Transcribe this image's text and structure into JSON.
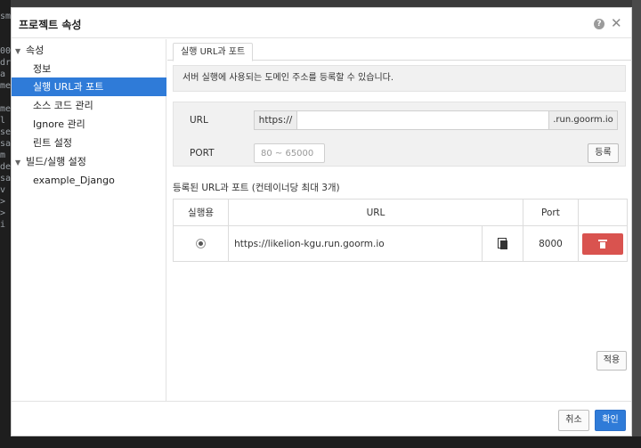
{
  "background": {
    "code_lines": [
      "sm",
      "",
      "00",
      "dr",
      "a",
      "me",
      "me",
      "l",
      "se",
      "sa",
      "m",
      "de",
      "sa",
      "dy",
      "v",
      ">",
      ">",
      "i"
    ]
  },
  "dialog": {
    "title": "프로젝트 속성",
    "help_glyph": "?",
    "close_glyph": "✕"
  },
  "sidebar": {
    "groups": [
      {
        "label": "속성",
        "expanded": true,
        "items": [
          "정보",
          "실행 URL과 포트",
          "소스 코드 관리",
          "Ignore 관리",
          "린트 설정"
        ]
      },
      {
        "label": "빌드/실행 설정",
        "expanded": true,
        "items": [
          "example_Django"
        ]
      }
    ],
    "selected": "실행 URL과 포트"
  },
  "tabs": {
    "active_label": "실행 URL과 포트"
  },
  "info": {
    "text": "서버 실행에 사용되는 도메인 주소를 등록할 수 있습니다."
  },
  "form": {
    "url_label": "URL",
    "url_prefix": "https://",
    "url_value": "",
    "url_suffix": ".run.goorm.io",
    "port_label": "PORT",
    "port_placeholder": "80 ~ 65000",
    "register_label": "등록"
  },
  "registered": {
    "title": "등록된 URL과 포트 (컨테이너당 최대 3개)",
    "columns": [
      "실행용",
      "URL",
      "",
      "Port",
      ""
    ],
    "rows": [
      {
        "url": "https://likelion-kgu.run.goorm.io",
        "port": "8000",
        "selected": true
      }
    ]
  },
  "apply_label": "적용",
  "footer": {
    "cancel_label": "취소",
    "confirm_label": "확인"
  },
  "colors": {
    "accent": "#2f7bd8",
    "danger": "#d9534f"
  }
}
